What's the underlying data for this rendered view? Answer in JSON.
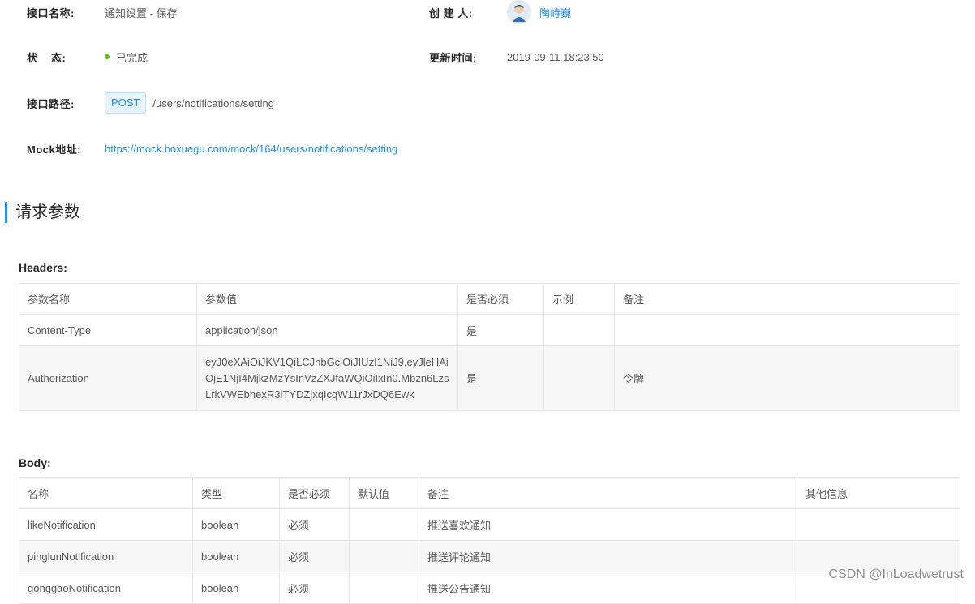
{
  "info": {
    "name_label": "接口名称:",
    "name_value": "通知设置 - 保存",
    "creator_label": "创 建 人:",
    "creator_name": "陶峙巍",
    "status_label": "状    态:",
    "status_value": "已完成",
    "updated_label": "更新时间:",
    "updated_value": "2019-09-11 18:23:50",
    "path_label": "接口路径:",
    "method": "POST",
    "path": "/users/notifications/setting",
    "mock_label": "Mock地址:",
    "mock_url": "https://mock.boxuegu.com/mock/164/users/notifications/setting"
  },
  "section_title": "请求参数",
  "headers": {
    "title": "Headers:",
    "columns": [
      "参数名称",
      "参数值",
      "是否必须",
      "示例",
      "备注"
    ],
    "rows": [
      {
        "name": "Content-Type",
        "value": "application/json",
        "required": "是",
        "example": "",
        "note": ""
      },
      {
        "name": "Authorization",
        "value": "eyJ0eXAiOiJKV1QiLCJhbGciOiJIUzI1NiJ9.eyJleHAiOjE1NjI4MjkzMzYsInVzZXJfaWQiOiIxIn0.Mbzn6LzsLrkVWEbhexR3lTYDZjxqIcqW11rJxDQ6Ewk",
        "required": "是",
        "example": "",
        "note": "令牌"
      }
    ]
  },
  "body": {
    "title": "Body:",
    "columns": [
      "名称",
      "类型",
      "是否必须",
      "默认值",
      "备注",
      "其他信息"
    ],
    "rows": [
      {
        "name": "likeNotification",
        "type": "boolean",
        "required": "必须",
        "default": "",
        "note": "推送喜欢通知",
        "other": ""
      },
      {
        "name": "pinglunNotification",
        "type": "boolean",
        "required": "必须",
        "default": "",
        "note": "推送评论通知",
        "other": ""
      },
      {
        "name": "gonggaoNotification",
        "type": "boolean",
        "required": "必须",
        "default": "",
        "note": "推送公告通知",
        "other": ""
      }
    ]
  },
  "watermark": "CSDN @InLoadwetrust",
  "colors": {
    "accent": "#1890ff",
    "status_done": "#52c41a",
    "border": "#e8e8e8",
    "stripe": "#f6f6f6"
  }
}
